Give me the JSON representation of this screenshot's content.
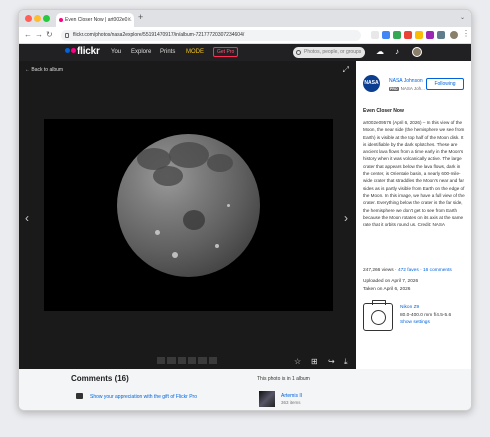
{
  "browser": {
    "tab_title": "Even Closer Now | art002e0...",
    "new_tab": "+",
    "url": "flickr.com/photos/nasa2explore/55191470917/in/album-72177720307234604/"
  },
  "flickr": {
    "logo": "flickr",
    "nav": [
      "You",
      "Explore",
      "Prints",
      "MODE"
    ],
    "get_pro": "Get Pro",
    "search_placeholder": "Photos, people, or groups"
  },
  "viewer": {
    "back_label": "Back to album"
  },
  "owner": {
    "logo_text": "NASA",
    "name": "NASA Johnson",
    "pro_badge": "PRO",
    "subname": "NASA Joh...",
    "follow_label": "Following"
  },
  "photo": {
    "title": "Even Closer Now",
    "description": "art002e09576 (April 6, 2026) – In this view of the Moon, the near side (the hemisphere we see from Earth) is visible at the top half of the Moon disk. It is identifiable by the dark splotches. These are ancient lava flows from a time early in the Moon's history when it was volcanically active. The large crater that appears below the lava flows, dark in the center, is Orientale basin, a nearly 600-mile-wide crater that straddles the Moon's near and far sides as is partly visible from Earth on the edge of the Moon. In this image, we have a full view of the crater. Everything below the crater is the far side, the hemisphere we don't get to see from Earth because the Moon rotates on its axis at the same rate that it orbits round us. Credit: NASA",
    "views": "247,266 views",
    "faves": "472 faves",
    "comments_count": "16 comments",
    "uploaded": "Uploaded on April 7, 2026",
    "taken": "Taken on April 6, 2026"
  },
  "camera": {
    "model": "Nikon Z9",
    "settings": "80.0-400.0 mm f/4.5-5.6",
    "show_settings": "Show settings"
  },
  "comments": {
    "title": "Comments (16)",
    "gift_text": "Show your appreciation with the gift of Flickr Pro"
  },
  "album": {
    "heading": "This photo is in 1 album",
    "name": "Artemis II",
    "count": "363 items"
  },
  "colors": {
    "flickr_blue": "#0063dc",
    "flickr_pink": "#ff0084"
  }
}
